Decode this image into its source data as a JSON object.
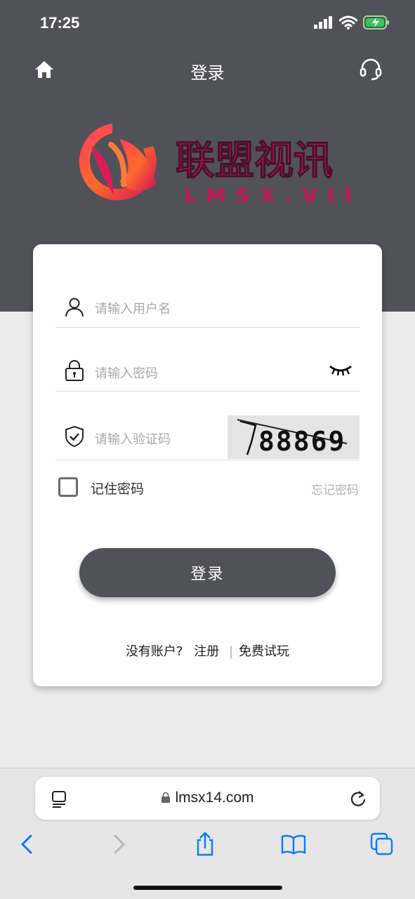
{
  "status_bar": {
    "time": "17:25"
  },
  "header": {
    "title": "登录"
  },
  "logo": {
    "chinese": "联盟视讯",
    "domain": "LMSX.VIP"
  },
  "form": {
    "username_placeholder": "请输入用户名",
    "password_placeholder": "请输入密码",
    "captcha_placeholder": "请输入验证码",
    "captcha_code": "88869",
    "remember_label": "记住密码",
    "forgot_label": "忘记密码",
    "login_button": "登录",
    "no_account": "没有账户?",
    "register": "注册",
    "separator": "|",
    "free_trial": "免费试玩"
  },
  "browser": {
    "url": "lmsx14.com"
  },
  "colors": {
    "header_bg": "#515259",
    "page_bg": "#ececec",
    "accent_blue": "#0a7aff",
    "logo_pink": "#e0205e"
  }
}
